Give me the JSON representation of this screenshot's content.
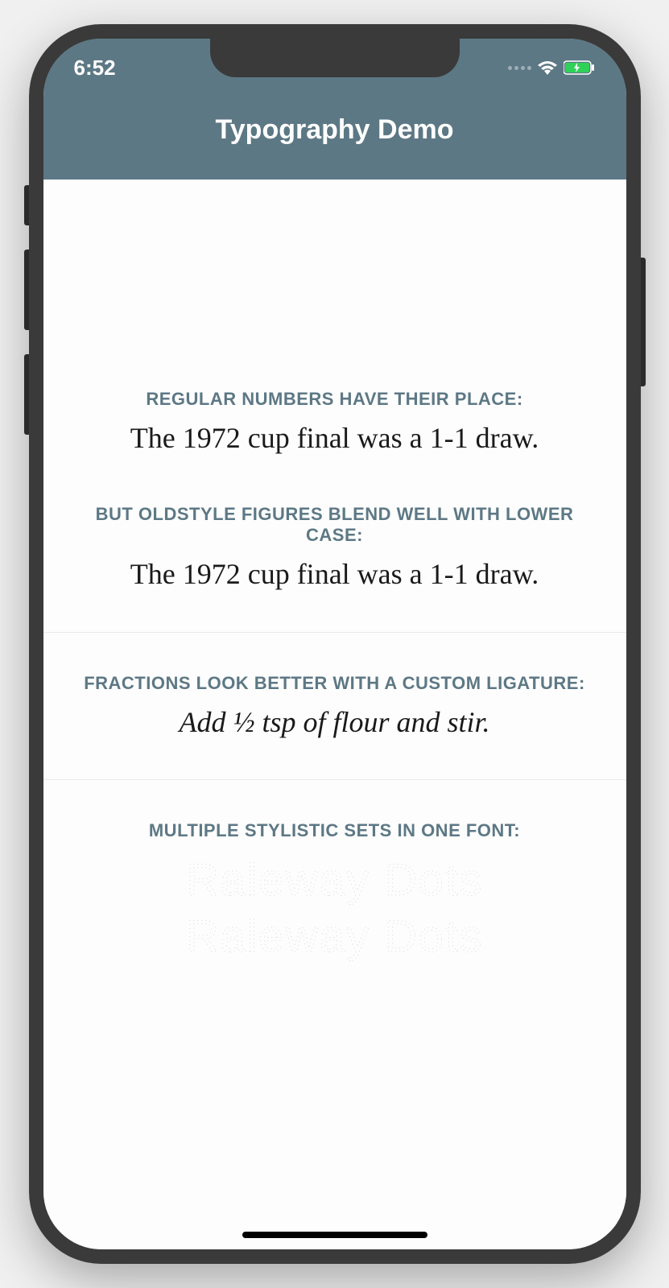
{
  "status": {
    "time": "6:52"
  },
  "nav": {
    "title": "Typography Demo"
  },
  "sections": {
    "s1": {
      "caption1": "REGULAR NUMBERS HAVE THEIR PLACE:",
      "text1": "The 1972 cup final was a 1-1 draw.",
      "caption2": "BUT OLDSTYLE FIGURES BLEND WELL WITH LOWER CASE:",
      "text2": "The 1972 cup final was a 1-1 draw."
    },
    "s2": {
      "caption": "FRACTIONS LOOK BETTER WITH A CUSTOM LIGATURE:",
      "text": "Add ½ tsp of flour and stir."
    },
    "s3": {
      "caption": "MULTIPLE STYLISTIC SETS IN ONE FONT:",
      "text1": "Raleway Dots",
      "text2": "Raleway Dots"
    }
  }
}
